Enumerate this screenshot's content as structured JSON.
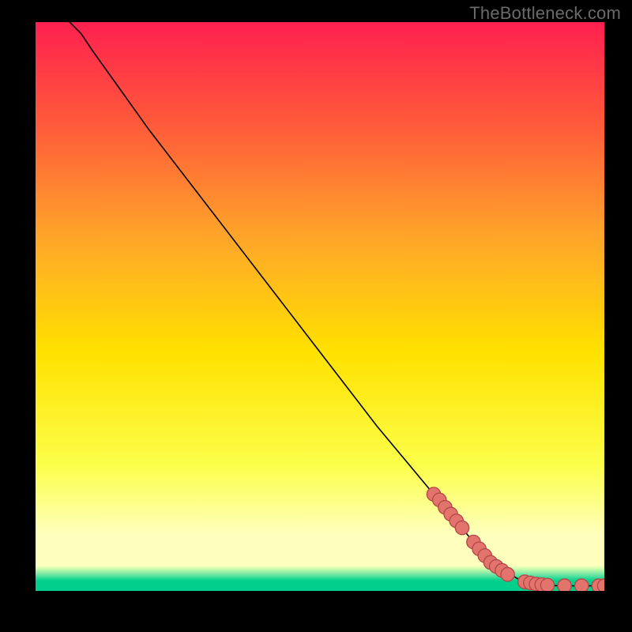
{
  "watermark": "TheBottleneck.com",
  "chart_data": {
    "type": "line",
    "title": "",
    "xlabel": "",
    "ylabel": "",
    "xlim": [
      0,
      100
    ],
    "ylim": [
      0,
      100
    ],
    "grid": false,
    "series": [
      {
        "name": "curve",
        "kind": "line",
        "x": [
          6,
          8,
          10,
          15,
          20,
          30,
          40,
          50,
          60,
          70,
          80,
          85,
          88,
          90,
          92,
          95,
          100
        ],
        "y": [
          100,
          98,
          95,
          88,
          81,
          68,
          55,
          42,
          29,
          17,
          5,
          2,
          1.2,
          1,
          0.9,
          0.9,
          0.9
        ]
      },
      {
        "name": "markers",
        "kind": "scatter",
        "x": [
          70,
          71,
          72,
          73,
          74,
          75,
          77,
          78,
          79,
          80,
          81,
          82,
          83,
          86,
          87,
          88,
          89,
          90,
          93,
          96,
          99,
          100
        ],
        "y": [
          17,
          16,
          14.7,
          13.5,
          12.3,
          11.1,
          8.6,
          7.4,
          6.2,
          5,
          4.3,
          3.6,
          2.9,
          1.6,
          1.4,
          1.2,
          1.1,
          1,
          0.9,
          0.9,
          0.9,
          0.9
        ]
      }
    ],
    "background_gradient": {
      "top_color": "#ff2050",
      "mid_color": "#ffe100",
      "pale_band": "#ffffbd",
      "band_color": "#00d08c",
      "bottom_band_height_frac": 0.018
    },
    "marker_style": {
      "fill": "#e2746d",
      "stroke": "#b74a49",
      "radius_frac": 0.012
    }
  }
}
